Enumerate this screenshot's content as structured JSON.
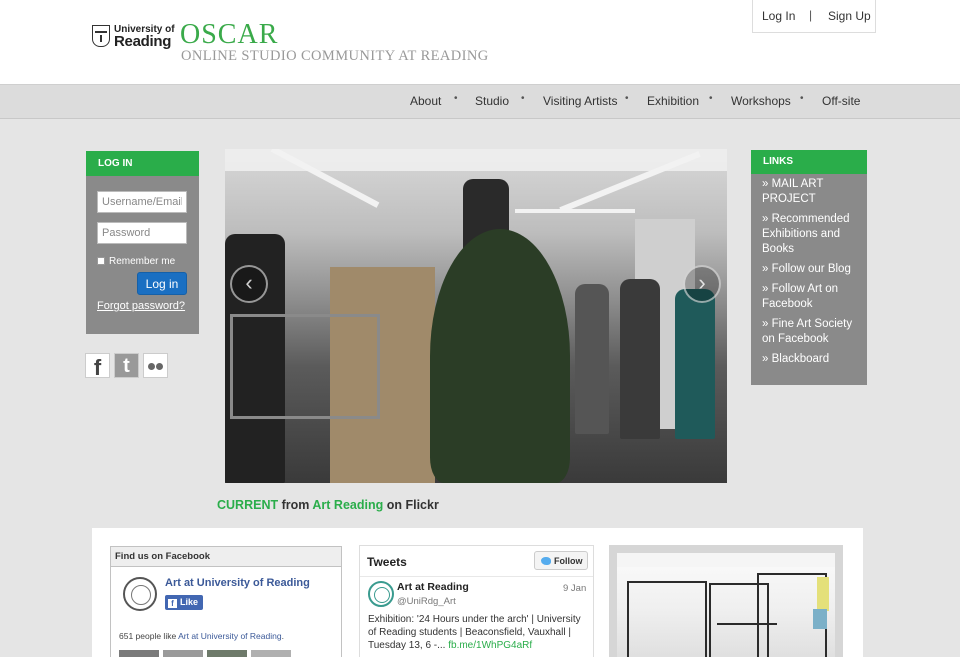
{
  "header": {
    "university_line1": "University of",
    "university_line2": "Reading",
    "brand_title": "OSCAR",
    "brand_subtitle": "ONLINE STUDIO COMMUNITY AT READING",
    "auth": {
      "login": "Log In",
      "separator": "|",
      "signup": "Sign Up"
    }
  },
  "nav": {
    "items": [
      "About",
      "Studio",
      "Visiting Artists",
      "Exhibition",
      "Workshops",
      "Off-site"
    ],
    "separator": "•"
  },
  "login_panel": {
    "title": "LOG IN",
    "username_placeholder": "Username/Email",
    "password_placeholder": "Password",
    "remember_label": "Remember me",
    "login_button": "Log in",
    "forgot_link": "Forgot password?"
  },
  "social": {
    "facebook_glyph": "f",
    "twitter_glyph": "t",
    "icons": [
      "facebook-icon",
      "twitter-icon",
      "flickr-icon"
    ]
  },
  "carousel": {
    "prev_glyph": "‹",
    "next_glyph": "›",
    "caption_current": "CURRENT",
    "caption_from": "from",
    "caption_source": "Art Reading",
    "caption_on": "on Flickr"
  },
  "links_panel": {
    "title": "LINKS",
    "items": [
      "» MAIL ART PROJECT",
      "» Recommended Exhibitions and Books",
      "» Follow our Blog",
      "» Follow Art on Facebook",
      "» Fine Art Society on Facebook",
      "» Blackboard"
    ]
  },
  "facebook_widget": {
    "title": "Find us on Facebook",
    "page_name": "Art at University of Reading",
    "like_glyph": "f",
    "like_button": "Like",
    "count_prefix": "651 people like",
    "count_link": "Art at University of Reading",
    "count_suffix": "."
  },
  "twitter_widget": {
    "title": "Tweets",
    "follow_button": "Follow",
    "tweet": {
      "name": "Art at Reading",
      "handle": "@UniRdg_Art",
      "date": "9 Jan",
      "text": "Exhibition: '24 Hours under the arch' | University of Reading students | Beaconsfield, Vauxhall | Tuesday 13, 6 -...",
      "link": "fb.me/1WhPG4aRf"
    }
  },
  "colors": {
    "brand_green": "#2aad4a",
    "panel_grey": "#8a8a8a",
    "login_blue": "#1a6fc2",
    "facebook_blue": "#3b5998",
    "twitter_blue": "#55acee"
  }
}
